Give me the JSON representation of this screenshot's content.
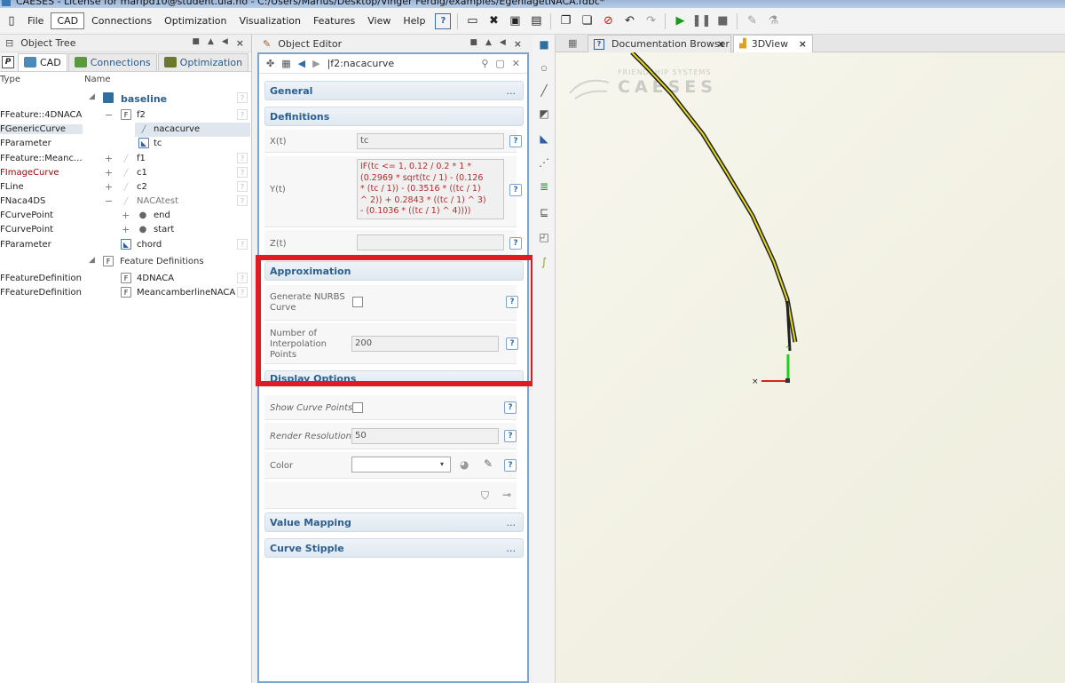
{
  "window": {
    "title": "CAESES - License for maripd10@student.uia.no - C:/Users/Marius/Desktop/Vinger Ferdig/examples/EgenlagetNACA.fdbc*"
  },
  "menu": {
    "items": [
      "File",
      "CAD",
      "Connections",
      "Optimization",
      "Visualization",
      "Features",
      "View",
      "Help"
    ],
    "active": "CAD"
  },
  "object_tree": {
    "title": "Object Tree",
    "tabs": [
      "CAD",
      "Connections",
      "Optimization"
    ],
    "tab_badge": "P",
    "columns": {
      "type": "Type",
      "name": "Name"
    },
    "rows": [
      {
        "type": "",
        "name": "baseline"
      },
      {
        "type": "FFeature::4DNACA",
        "expander": "−",
        "name": "f2"
      },
      {
        "type": "FGenericCurve",
        "name": "nacacurve"
      },
      {
        "type": "FParameter",
        "name": "tc"
      },
      {
        "type": "FFeature::Meanc...",
        "expander": "+",
        "name": "f1"
      },
      {
        "type": "FImageCurve",
        "expander": "+",
        "name": "c1"
      },
      {
        "type": "FLine",
        "expander": "+",
        "name": "c2"
      },
      {
        "type": "FNaca4DS",
        "expander": "−",
        "name": "NACAtest"
      },
      {
        "type": "FCurvePoint",
        "expander": "+",
        "name": "end"
      },
      {
        "type": "FCurvePoint",
        "expander": "+",
        "name": "start"
      },
      {
        "type": "FParameter",
        "name": "chord"
      },
      {
        "type": "",
        "name": "Feature Definitions"
      },
      {
        "type": "FFeatureDefinition",
        "name": "4DNACA"
      },
      {
        "type": "FFeatureDefinition",
        "name": "MeancamberlineNACA"
      }
    ]
  },
  "object_editor": {
    "title": "Object Editor",
    "path": "|f2:nacacurve",
    "sections": {
      "general": "General",
      "definitions": "Definitions",
      "approximation": "Approximation",
      "display": "Display Options",
      "value_mapping": "Value Mapping",
      "curve_stipple": "Curve Stipple"
    },
    "section_more": "...",
    "fields": {
      "x_label": "X(t)",
      "x_value": "tc",
      "y_label": "Y(t)",
      "z_label": "Z(t)",
      "z_value": "",
      "nurbs_label_1": "Generate NURBS",
      "nurbs_label_2": "Curve",
      "interp_label_1": "Number of",
      "interp_label_2": "Interpolation",
      "interp_label_3": "Points",
      "interp_value": "200",
      "show_points_label": "Show Curve Points",
      "render_label": "Render Resolution",
      "render_value": "50",
      "color_label": "Color"
    },
    "y_formula": [
      "IF(tc <= 1, 0.12 / 0.2 * 1 *",
      "(0.2969 * sqrt(tc / 1) - (0.126",
      "* (tc / 1)) - (0.3516 * ((tc / 1)",
      "^ 2)) + 0.2843 * ((tc / 1) ^ 3)",
      "- (0.1036 * ((tc / 1) ^ 4))))"
    ],
    "help": "?"
  },
  "view_tabs": [
    {
      "label": "Documentation Browser"
    },
    {
      "label": "3DView"
    }
  ],
  "view3d": {
    "logo_small": "FRIENDSHIP SYSTEMS",
    "logo_big": "CAESES"
  },
  "colors": {
    "accent": "#2c5f8f",
    "highlight": "#e01b24",
    "curve": "#e6d81a"
  }
}
